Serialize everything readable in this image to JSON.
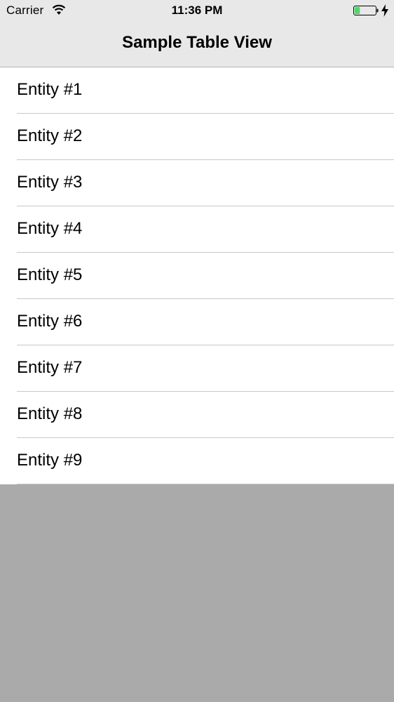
{
  "status_bar": {
    "carrier": "Carrier",
    "time": "11:36 PM",
    "icons": [
      "wifi-icon",
      "battery-icon",
      "charging-icon"
    ],
    "battery_level": 0.25
  },
  "navigation": {
    "title": "Sample Table View"
  },
  "table": {
    "rows": [
      {
        "label": "Entity #1"
      },
      {
        "label": "Entity #2"
      },
      {
        "label": "Entity #3"
      },
      {
        "label": "Entity #4"
      },
      {
        "label": "Entity #5"
      },
      {
        "label": "Entity #6"
      },
      {
        "label": "Entity #7"
      },
      {
        "label": "Entity #8"
      },
      {
        "label": "Entity #9"
      }
    ]
  },
  "colors": {
    "nav_background": "#e8e8e8",
    "table_background": "#ffffff",
    "overlay_background": "#aaaaaa",
    "separator": "#c8c7cc",
    "battery_fill": "#4cd964"
  }
}
